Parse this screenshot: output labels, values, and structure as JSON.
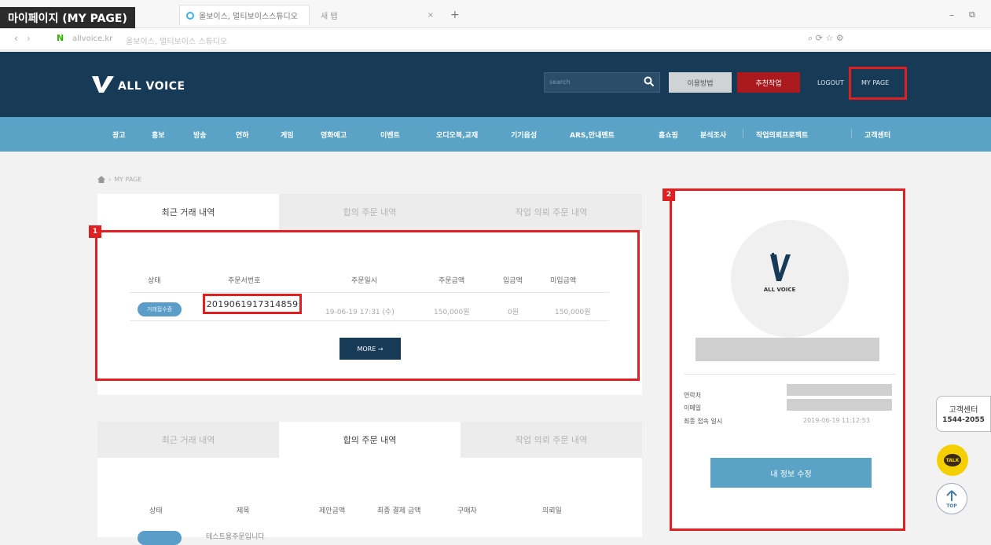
{
  "page_label": "마이페이지 (MY PAGE)",
  "browser": {
    "tabs": [
      "올보이스, 멀티보이스스튜디오",
      "새 탭"
    ],
    "url_domain": "allvoice.kr",
    "url_title": "올보이스, 멀티보이스 스튜디오"
  },
  "header": {
    "logo_text": "ALL VOICE",
    "search_placeholder": "search",
    "guide_label": "이용방법",
    "recommend_label": "추천작업",
    "logout_label": "LOGOUT",
    "mypage_label": "MY PAGE"
  },
  "nav": {
    "items": [
      "광고",
      "홍보",
      "방송",
      "연하",
      "게임",
      "영화예고",
      "이벤트",
      "오디오북,교재",
      "기기음성",
      "ARS,안내멘트",
      "홈쇼핑",
      "분석조사",
      "작업의뢰프로젝트",
      "고객센터"
    ]
  },
  "breadcrumb": "MY PAGE",
  "tabs1": [
    "최근 거래 내역",
    "합의 주문 내역",
    "작업 의뢰 주문 내역"
  ],
  "tabs2": [
    "최근 거래 내역",
    "합의 주문 내역",
    "작업 의뢰 주문 내역"
  ],
  "table1": {
    "headers": [
      "상태",
      "주문서번호",
      "주문일시",
      "주문금액",
      "입금액",
      "미입금액"
    ],
    "row": {
      "status": "거래접수중",
      "order_no": "2019061917314859",
      "date": "19-06-19 17:31 (수)",
      "amount": "150,000원",
      "paid": "0원",
      "unpaid": "150,000원"
    },
    "more_label": "MORE →"
  },
  "table2": {
    "headers": [
      "상태",
      "제목",
      "제안금액",
      "최종 결제 금액",
      "구매자",
      "의뢰일"
    ],
    "row_title": "테스트용주문입니다"
  },
  "annotations": [
    "1",
    "2"
  ],
  "profile": {
    "avatar_text": "ALL VOICE",
    "contact_label": "연락처",
    "email_label": "이메일",
    "last_login_label": "최종 접속 일시",
    "last_login_value": "2019-06-19 11:12:53",
    "edit_label": "내 정보 수정"
  },
  "floating": {
    "cs_title": "고객센터",
    "cs_phone": "1544-2055",
    "talk_label": "TALK",
    "top_label": "TOP"
  },
  "colors": {
    "header_navy": "#173a57",
    "nav_blue": "#5aa3c6",
    "highlight_red": "#e02020",
    "recommend_red": "#a9191d"
  }
}
